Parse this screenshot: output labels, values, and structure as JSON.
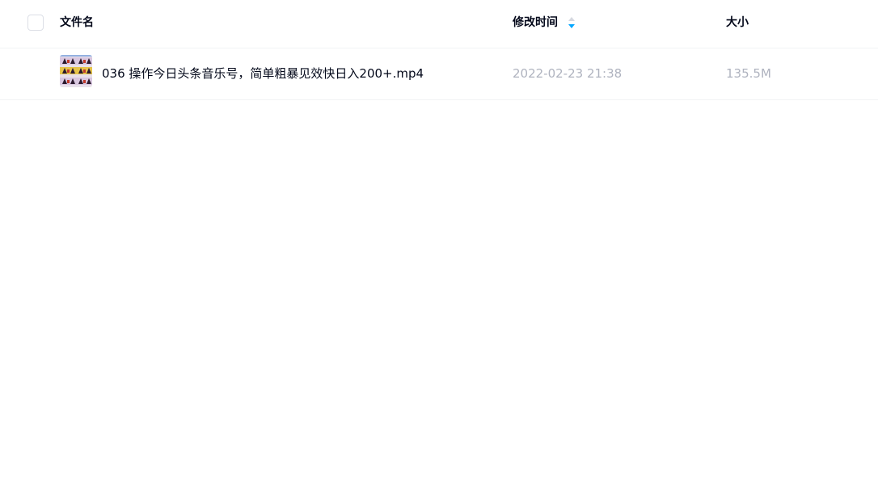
{
  "table": {
    "header": {
      "name_label": "文件名",
      "time_label": "修改时间",
      "size_label": "大小",
      "sort_icon": "sort-arrows-icon"
    },
    "files": [
      {
        "name": "036 操作今日头条音乐号，简单粗暴见效快日入200+.mp4",
        "modified": "2022-02-23 21:38",
        "size": "135.5M",
        "thumbnail_icon": "video-thumbnail-icon"
      }
    ]
  },
  "colors": {
    "header_text": "#03081a",
    "muted_text": "#afb3bf",
    "accent": "#06a7ff",
    "divider": "#f2f3f5"
  }
}
